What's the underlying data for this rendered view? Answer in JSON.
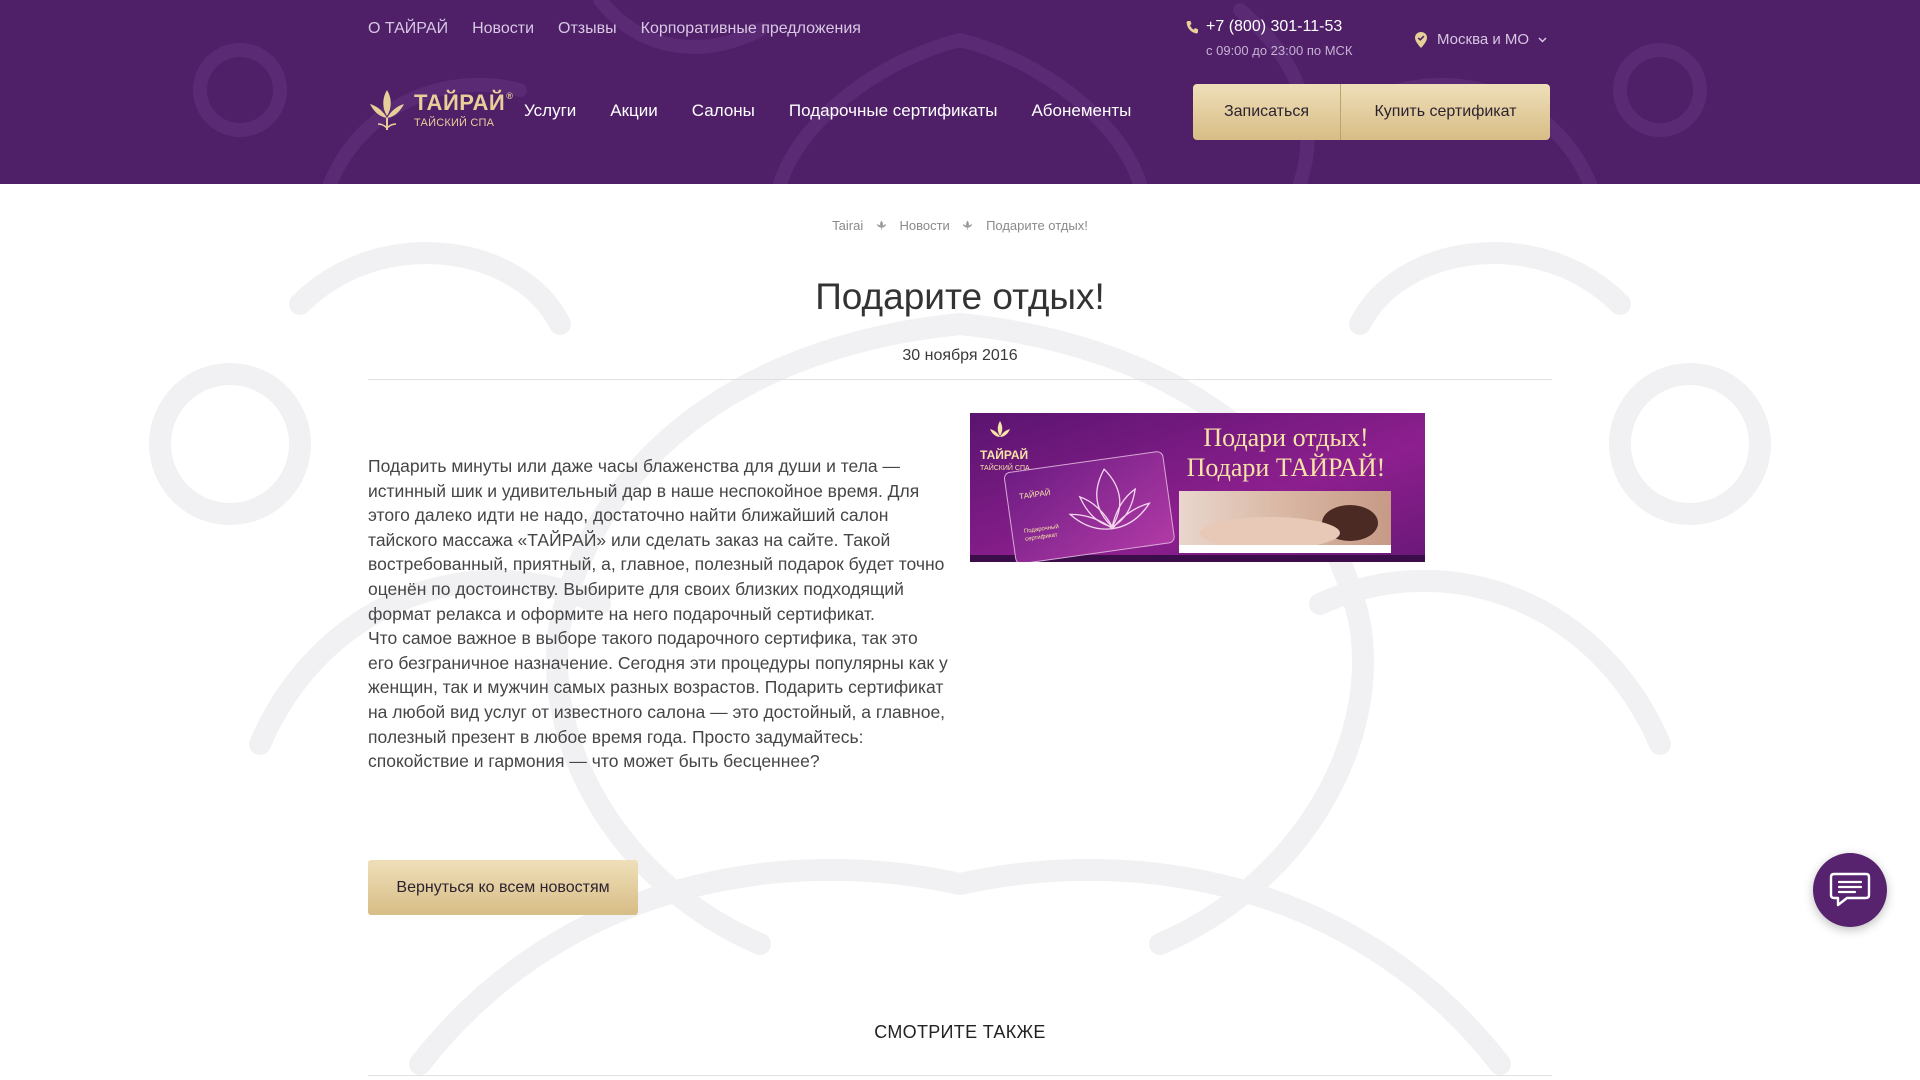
{
  "colors": {
    "header_bg": "#4f1f68",
    "gold_accent": "#e7cf99",
    "button_gold": "#d7bd86",
    "text_dark": "#333333"
  },
  "topnav": {
    "items": [
      {
        "label": "О ТАЙРАЙ"
      },
      {
        "label": "Новости"
      },
      {
        "label": "Отзывы"
      },
      {
        "label": "Корпоративные предложения"
      }
    ]
  },
  "contact": {
    "phone": "+7 (800) 301-11-53",
    "hours": "с 09:00 до 23:00 по МСК",
    "phone_icon": "phone-icon"
  },
  "city": {
    "label": "Москва и МО",
    "icon": "location-pin-icon"
  },
  "logo": {
    "title": "ТАЙРАЙ",
    "reg": "®",
    "subtitle": "ТАЙСКИЙ СПА"
  },
  "mainnav": {
    "items": [
      {
        "label": "Услуги"
      },
      {
        "label": "Акции"
      },
      {
        "label": "Салоны"
      },
      {
        "label": "Подарочные сертификаты"
      },
      {
        "label": "Абонементы"
      }
    ]
  },
  "header_buttons": {
    "book": "Записаться",
    "buy": "Купить сертификат"
  },
  "breadcrumb": {
    "items": [
      "Tairai",
      "Новости",
      "Подарите отдых!"
    ],
    "separator_icon": "leaf-separator-icon"
  },
  "article": {
    "title": "Подарите отдых!",
    "date": "30 ноября 2016",
    "paragraphs": [
      "Подарить минуты или даже часы блаженства для души и тела — истинный шик и удивительный дар в наше неспокойное время. Для этого далеко идти не надо, достаточно найти ближайший салон тайского массажа «ТАЙРАЙ» или сделать заказ на сайте. Такой востребованный, приятный, а, главное, полезный подарок будет точно оценён по достоинству. Выбирите для своих близких подходящий формат релакса и оформите на него подарочный сертификат.",
      "Что самое важное в выборе такого подарочного сертифика, так это его безграничное назначение. Сегодня эти процедуры популярны как у женщин, так и мужчин самых разных возрастов. Подарить сертификат на любой вид услуг от известного салона — это достойный, а главное, полезный презент в любое время года. Просто задумайтесь: спокойствие и гармония — что может быть бесценнее?"
    ],
    "back_button": "Вернуться ко всем новостям"
  },
  "banner": {
    "line1": "Подари отдых!",
    "line2": "Подари  ТАЙРАЙ!",
    "logo_title": "ТАЙРАЙ",
    "logo_sub": "ТАЙСКИЙ СПА",
    "card_logo": "ТАЙРАЙ",
    "card_text_1": "Подарочный",
    "card_text_2": "сертификат"
  },
  "see_also": {
    "title": "СМОТРИТЕ ТАКЖЕ"
  },
  "chat": {
    "icon": "chat-bubble-icon"
  }
}
